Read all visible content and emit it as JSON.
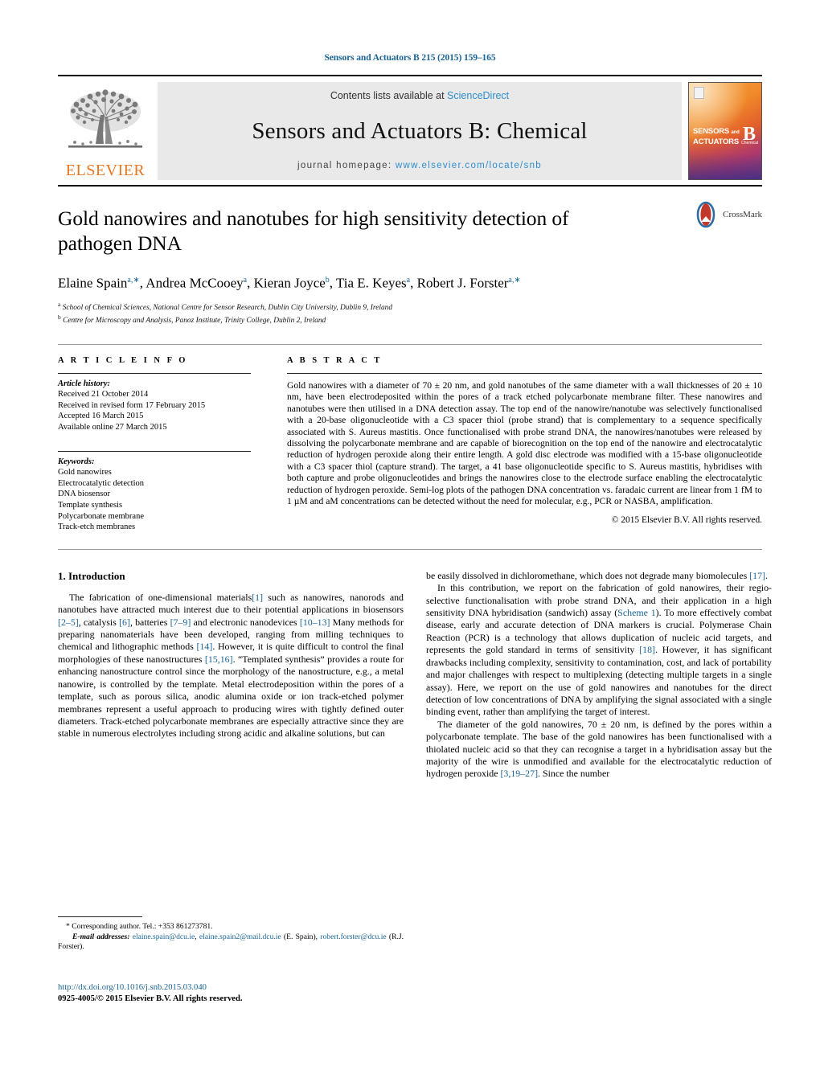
{
  "running_head": "Sensors and Actuators B 215 (2015) 159–165",
  "masthead": {
    "publisher_logo_text": "ELSEVIER",
    "contents_prefix": "Contents lists available at ",
    "contents_link": "ScienceDirect",
    "journal_title": "Sensors and Actuators B: Chemical",
    "homepage_prefix": "journal homepage: ",
    "homepage_url": "www.elsevier.com/locate/snb",
    "cover": {
      "line1": "SENSORS",
      "and": "and",
      "line2": "ACTUATORS",
      "letter": "B",
      "sub": "Chemical"
    }
  },
  "article": {
    "title": "Gold nanowires and nanotubes for high sensitivity detection of pathogen DNA",
    "crossmark_label": "CrossMark",
    "authors_html": "Elaine Spain<sup>a,∗</sup>, Andrea McCooey<sup>a</sup>, Kieran Joyce<sup>b</sup>, Tia E. Keyes<sup>a</sup>, Robert J. Forster<sup>a,∗</sup>",
    "affiliations": [
      "School of Chemical Sciences, National Centre for Sensor Research, Dublin City University, Dublin 9, Ireland",
      "Centre for Microscopy and Analysis, Panoz Institute, Trinity College, Dublin 2, Ireland"
    ],
    "affiliation_marks": [
      "a",
      "b"
    ]
  },
  "info": {
    "heading": "A R T I C L E   I N F O",
    "history_title": "Article history:",
    "history": [
      "Received 21 October 2014",
      "Received in revised form 17 February 2015",
      "Accepted 16 March 2015",
      "Available online 27 March 2015"
    ],
    "keywords_title": "Keywords:",
    "keywords": [
      "Gold nanowires",
      "Electrocatalytic detection",
      "DNA biosensor",
      "Template synthesis",
      "Polycarbonate membrane",
      "Track-etch membranes"
    ]
  },
  "abstract": {
    "heading": "A B S T R A C T",
    "text": "Gold nanowires with a diameter of 70 ± 20 nm, and gold nanotubes of the same diameter with a wall thicknesses of 20 ± 10 nm, have been electrodeposited within the pores of a track etched polycarbonate membrane filter. These nanowires and nanotubes were then utilised in a DNA detection assay. The top end of the nanowire/nanotube was selectively functionalised with a 20-base oligonucleotide with a C3 spacer thiol (probe strand) that is complementary to a sequence specifically associated with S. Aureus mastitis. Once functionalised with probe strand DNA, the nanowires/nanotubes were released by dissolving the polycarbonate membrane and are capable of biorecognition on the top end of the nanowire and electrocatalytic reduction of hydrogen peroxide along their entire length. A gold disc electrode was modified with a 15-base oligonucleotide with a C3 spacer thiol (capture strand). The target, a 41 base oligonucleotide specific to S. Aureus mastitis, hybridises with both capture and probe oligonucleotides and brings the nanowires close to the electrode surface enabling the electrocatalytic reduction of hydrogen peroxide. Semi-log plots of the pathogen DNA concentration vs. faradaic current are linear from 1 fM to 1 µM and aM concentrations can be detected without the need for molecular, e.g., PCR or NASBA, amplification.",
    "copyright": "© 2015 Elsevier B.V. All rights reserved."
  },
  "body": {
    "section_number_title": "1.  Introduction",
    "left_paragraph_1_parts": {
      "p1a": "The fabrication of one-dimensional materials",
      "r1": "[1]",
      "p1b": " such as nanowires, nanorods and nanotubes have attracted much interest due to their potential applications in biosensors ",
      "r2": "[2–5]",
      "p1c": ", catalysis ",
      "r3": "[6]",
      "p1d": ", batteries ",
      "r4": "[7–9]",
      "p1e": " and electronic nanodevices ",
      "r5": "[10–13]",
      "p1f": " Many methods for preparing nanomaterials have been developed, ranging from milling techniques to chemical and lithographic methods ",
      "r6": "[14]",
      "p1g": ". However, it is quite difficult to control the final morphologies of these nanostructures ",
      "r7": "[15,16]",
      "p1h": ". “Templated synthesis” provides a route for enhancing nanostructure control since the morphology of the nanostructure, e.g., a metal nanowire, is controlled by the template. Metal electrodeposition within the pores of a template, such as porous silica, anodic alumina oxide or ion track-etched polymer membranes represent a useful approach to producing wires with tightly defined outer diameters. Track-etched polycarbonate membranes are especially attractive since they are stable in numerous electrolytes including strong acidic and alkaline solutions, but can"
    },
    "right_paragraph_1_parts": {
      "p1a": "be easily dissolved in dichloromethane, which does not degrade many biomolecules ",
      "r1": "[17]",
      "p1b": "."
    },
    "right_paragraph_2_parts": {
      "p2a": "In this contribution, we report on the fabrication of gold nanowires, their regio-selective functionalisation with probe strand DNA, and their application in a high sensitivity DNA hybridisation (sandwich) assay (",
      "scheme": "Scheme 1",
      "p2b": "). To more effectively combat disease, early and accurate detection of DNA markers is crucial. Polymerase Chain Reaction (PCR) is a technology that allows duplication of nucleic acid targets, and represents the gold standard in terms of sensitivity ",
      "r2": "[18]",
      "p2c": ". However, it has significant drawbacks including complexity, sensitivity to contamination, cost, and lack of portability and major challenges with respect to multiplexing (detecting multiple targets in a single assay). Here, we report on the use of gold nanowires and nanotubes for the direct detection of low concentrations of DNA by amplifying the signal associated with a single binding event, rather than amplifying the target of interest."
    },
    "right_paragraph_3_parts": {
      "p3a": "The diameter of the gold nanowires, 70 ± 20 nm, is defined by the pores within a polycarbonate template. The base of the gold nanowires has been functionalised with a thiolated nucleic acid so that they can recognise a target in a hybridisation assay but the majority of the wire is unmodified and available for the electrocatalytic reduction of hydrogen peroxide ",
      "r3": "[3,19–27]",
      "p3b": ". Since the number"
    }
  },
  "footnote": {
    "corresponding": "* Corresponding author. Tel.: +353 861273781.",
    "email_label": "E-mail addresses:",
    "email1": "elaine.spain@dcu.ie",
    "email2": "elaine.spain2@mail.dcu.ie",
    "email_owner1": "(E. Spain),",
    "email3": "robert.forster@dcu.ie",
    "email_owner2": "(R.J. Forster)."
  },
  "doi_block": {
    "doi": "http://dx.doi.org/10.1016/j.snb.2015.03.040",
    "issn_line": "0925-4005/© 2015 Elsevier B.V. All rights reserved."
  },
  "colors": {
    "link": "#1a6496",
    "sciencedirect": "#2e8ece",
    "elsevier_orange": "#E87722",
    "masthead_bg": "#e9e9e9"
  }
}
